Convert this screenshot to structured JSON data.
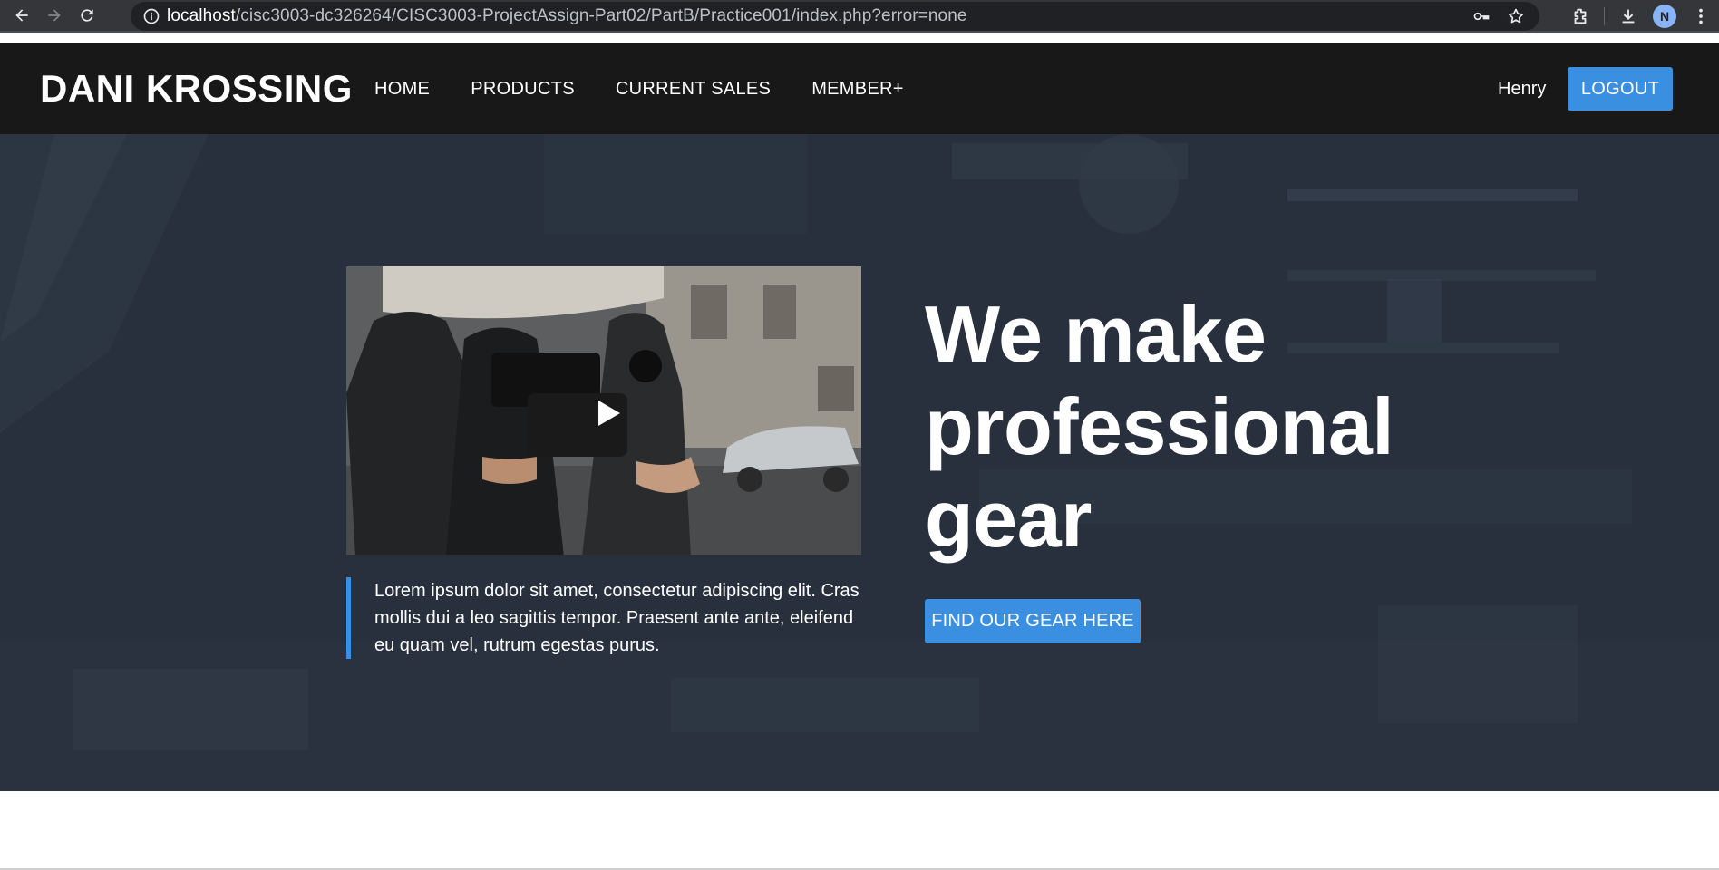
{
  "browser": {
    "url_host": "localhost",
    "url_path": "/cisc3003-dc326264/CISC3003-ProjectAssign-Part02/PartB/Practice001/index.php?error=none",
    "avatar_letter": "N",
    "icons": [
      "back-arrow-icon",
      "forward-arrow-icon",
      "reload-icon",
      "info-icon",
      "key-icon",
      "star-icon",
      "extensions-icon",
      "download-icon",
      "more-vert-icon"
    ]
  },
  "header": {
    "logo": "DANI KROSSING",
    "nav": [
      "HOME",
      "PRODUCTS",
      "CURRENT SALES",
      "MEMBER+"
    ],
    "user_name": "Henry",
    "logout_label": "LOGOUT"
  },
  "hero": {
    "headline": "We make professional gear",
    "quote": "Lorem ipsum dolor sit amet, consectetur adipiscing elit. Cras mollis dui a leo sagittis tempor. Praesent ante ante, eleifend eu quam vel, rutrum egestas purus.",
    "cta_label": "FIND OUR GEAR HERE"
  },
  "colors": {
    "accent": "#3a8fe0",
    "header_bg": "#181818",
    "hero_bg": "#27303c"
  }
}
